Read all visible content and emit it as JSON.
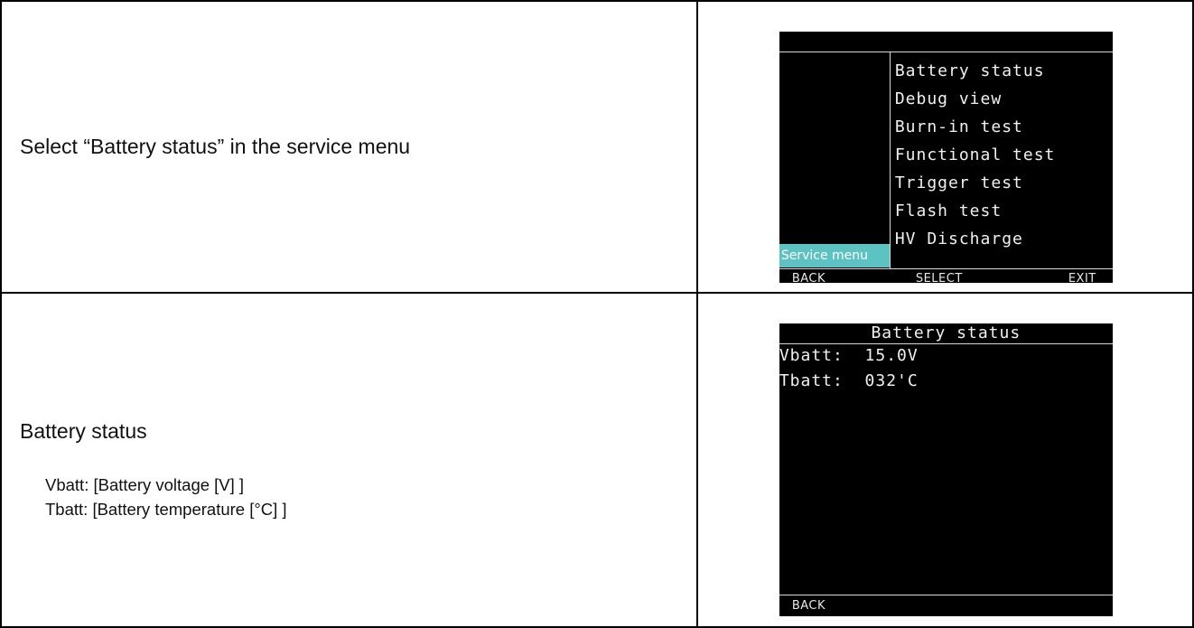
{
  "rows": [
    {
      "instruction": "Select “Battery status” in the service menu",
      "screen": {
        "menu_items": [
          "Battery status",
          "Debug view",
          "Burn-in test",
          "Functional test",
          "Trigger test",
          "Flash test",
          "HV Discharge"
        ],
        "menu_tag": "Service menu",
        "softkeys": {
          "left": "BACK",
          "center": "SELECT",
          "right": "EXIT"
        }
      }
    },
    {
      "instruction": "Battery status",
      "details": [
        "Vbatt: [Battery voltage [V] ]",
        "Tbatt: [Battery temperature [°C] ]"
      ],
      "screen": {
        "title": "Battery status",
        "lines": [
          "Vbatt:  15.0V",
          "Tbatt:  032'C"
        ],
        "softkeys": {
          "left": "BACK"
        }
      }
    }
  ]
}
